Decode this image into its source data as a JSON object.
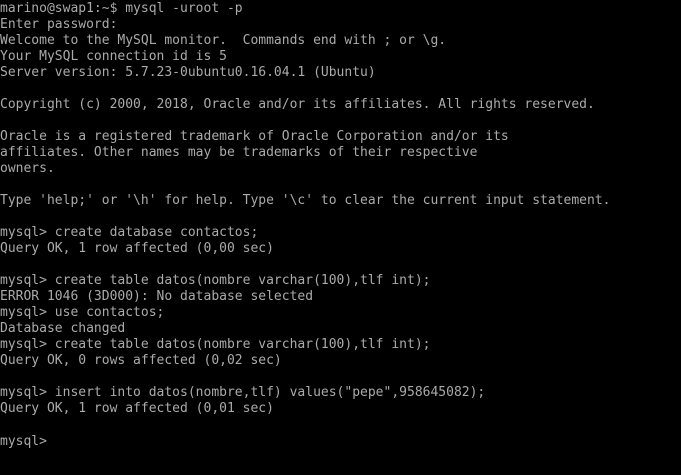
{
  "terminal": {
    "lines": [
      "marino@swap1:~$ mysql -uroot -p",
      "Enter password:",
      "Welcome to the MySQL monitor.  Commands end with ; or \\g.",
      "Your MySQL connection id is 5",
      "Server version: 5.7.23-0ubuntu0.16.04.1 (Ubuntu)",
      "",
      "Copyright (c) 2000, 2018, Oracle and/or its affiliates. All rights reserved.",
      "",
      "Oracle is a registered trademark of Oracle Corporation and/or its",
      "affiliates. Other names may be trademarks of their respective",
      "owners.",
      "",
      "Type 'help;' or '\\h' for help. Type '\\c' to clear the current input statement.",
      "",
      "mysql> create database contactos;",
      "Query OK, 1 row affected (0,00 sec)",
      "",
      "mysql> create table datos(nombre varchar(100),tlf int);",
      "ERROR 1046 (3D000): No database selected",
      "mysql> use contactos;",
      "Database changed",
      "mysql> create table datos(nombre varchar(100),tlf int);",
      "Query OK, 0 rows affected (0,02 sec)",
      "",
      "mysql> insert into datos(nombre,tlf) values(\"pepe\",958645082);",
      "Query OK, 1 row affected (0,01 sec)",
      "",
      "mysql>"
    ],
    "colors": {
      "background": "#000000",
      "foreground": "#aaaaaa"
    }
  }
}
